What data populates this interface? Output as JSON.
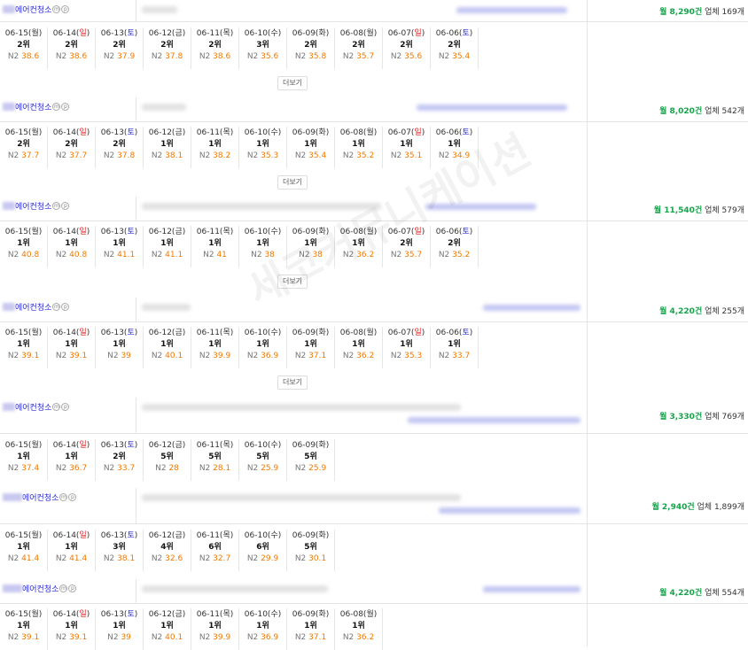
{
  "watermark": "세코커뮤니케이션",
  "more_label": "더보기",
  "mini_badges": [
    "m",
    "p"
  ],
  "blocks": [
    {
      "keyword": "에어컨청소",
      "volume": "월 8,290건",
      "companies": "업체 169개",
      "has_more": true,
      "days": [
        {
          "date": "06-15",
          "wd": "월",
          "rank": "2위",
          "n2": "38.6"
        },
        {
          "date": "06-14",
          "wd": "일",
          "rank": "2위",
          "n2": "38.6"
        },
        {
          "date": "06-13",
          "wd": "토",
          "rank": "2위",
          "n2": "37.9"
        },
        {
          "date": "06-12",
          "wd": "금",
          "rank": "2위",
          "n2": "37.8"
        },
        {
          "date": "06-11",
          "wd": "목",
          "rank": "2위",
          "n2": "38.6"
        },
        {
          "date": "06-10",
          "wd": "수",
          "rank": "3위",
          "n2": "35.6"
        },
        {
          "date": "06-09",
          "wd": "화",
          "rank": "2위",
          "n2": "35.8"
        },
        {
          "date": "06-08",
          "wd": "월",
          "rank": "2위",
          "n2": "35.7"
        },
        {
          "date": "06-07",
          "wd": "일",
          "rank": "2위",
          "n2": "35.6"
        },
        {
          "date": "06-06",
          "wd": "토",
          "rank": "2위",
          "n2": "35.4"
        }
      ]
    },
    {
      "keyword": "에어컨청소",
      "volume": "월 8,020건",
      "companies": "업체 542개",
      "has_more": true,
      "days": [
        {
          "date": "06-15",
          "wd": "월",
          "rank": "2위",
          "n2": "37.7"
        },
        {
          "date": "06-14",
          "wd": "일",
          "rank": "2위",
          "n2": "37.7"
        },
        {
          "date": "06-13",
          "wd": "토",
          "rank": "2위",
          "n2": "37.8"
        },
        {
          "date": "06-12",
          "wd": "금",
          "rank": "1위",
          "n2": "38.1"
        },
        {
          "date": "06-11",
          "wd": "목",
          "rank": "1위",
          "n2": "38.2"
        },
        {
          "date": "06-10",
          "wd": "수",
          "rank": "1위",
          "n2": "35.3"
        },
        {
          "date": "06-09",
          "wd": "화",
          "rank": "1위",
          "n2": "35.4"
        },
        {
          "date": "06-08",
          "wd": "월",
          "rank": "1위",
          "n2": "35.2"
        },
        {
          "date": "06-07",
          "wd": "일",
          "rank": "1위",
          "n2": "35.1"
        },
        {
          "date": "06-06",
          "wd": "토",
          "rank": "1위",
          "n2": "34.9"
        }
      ]
    },
    {
      "keyword": "에어컨청소",
      "volume": "월 11,540건",
      "companies": "업체 579개",
      "has_more": true,
      "days": [
        {
          "date": "06-15",
          "wd": "월",
          "rank": "1위",
          "n2": "40.8"
        },
        {
          "date": "06-14",
          "wd": "일",
          "rank": "1위",
          "n2": "40.8"
        },
        {
          "date": "06-13",
          "wd": "토",
          "rank": "1위",
          "n2": "41.1"
        },
        {
          "date": "06-12",
          "wd": "금",
          "rank": "1위",
          "n2": "41.1"
        },
        {
          "date": "06-11",
          "wd": "목",
          "rank": "1위",
          "n2": "41"
        },
        {
          "date": "06-10",
          "wd": "수",
          "rank": "1위",
          "n2": "38"
        },
        {
          "date": "06-09",
          "wd": "화",
          "rank": "1위",
          "n2": "38"
        },
        {
          "date": "06-08",
          "wd": "월",
          "rank": "1위",
          "n2": "36.2"
        },
        {
          "date": "06-07",
          "wd": "일",
          "rank": "2위",
          "n2": "35.7"
        },
        {
          "date": "06-06",
          "wd": "토",
          "rank": "2위",
          "n2": "35.2"
        }
      ]
    },
    {
      "keyword": "에어컨청소",
      "volume": "월 4,220건",
      "companies": "업체 255개",
      "has_more": true,
      "days": [
        {
          "date": "06-15",
          "wd": "월",
          "rank": "1위",
          "n2": "39.1"
        },
        {
          "date": "06-14",
          "wd": "일",
          "rank": "1위",
          "n2": "39.1"
        },
        {
          "date": "06-13",
          "wd": "토",
          "rank": "1위",
          "n2": "39"
        },
        {
          "date": "06-12",
          "wd": "금",
          "rank": "1위",
          "n2": "40.1"
        },
        {
          "date": "06-11",
          "wd": "목",
          "rank": "1위",
          "n2": "39.9"
        },
        {
          "date": "06-10",
          "wd": "수",
          "rank": "1위",
          "n2": "36.9"
        },
        {
          "date": "06-09",
          "wd": "화",
          "rank": "1위",
          "n2": "37.1"
        },
        {
          "date": "06-08",
          "wd": "월",
          "rank": "1위",
          "n2": "36.2"
        },
        {
          "date": "06-07",
          "wd": "일",
          "rank": "1위",
          "n2": "35.3"
        },
        {
          "date": "06-06",
          "wd": "토",
          "rank": "1위",
          "n2": "33.7"
        }
      ]
    },
    {
      "keyword": "에어컨청소",
      "volume": "월 3,330건",
      "companies": "업체 769개",
      "has_more": false,
      "days": [
        {
          "date": "06-15",
          "wd": "월",
          "rank": "1위",
          "n2": "37.4"
        },
        {
          "date": "06-14",
          "wd": "일",
          "rank": "1위",
          "n2": "36.7"
        },
        {
          "date": "06-13",
          "wd": "토",
          "rank": "2위",
          "n2": "33.7"
        },
        {
          "date": "06-12",
          "wd": "금",
          "rank": "5위",
          "n2": "28"
        },
        {
          "date": "06-11",
          "wd": "목",
          "rank": "5위",
          "n2": "28.1"
        },
        {
          "date": "06-10",
          "wd": "수",
          "rank": "5위",
          "n2": "25.9"
        },
        {
          "date": "06-09",
          "wd": "화",
          "rank": "5위",
          "n2": "25.9"
        }
      ]
    },
    {
      "keyword": "에어컨청소",
      "volume": "월 2,940건",
      "companies": "업체 1,899개",
      "has_more": false,
      "days": [
        {
          "date": "06-15",
          "wd": "월",
          "rank": "1위",
          "n2": "41.4"
        },
        {
          "date": "06-14",
          "wd": "일",
          "rank": "1위",
          "n2": "41.4"
        },
        {
          "date": "06-13",
          "wd": "토",
          "rank": "3위",
          "n2": "38.1"
        },
        {
          "date": "06-12",
          "wd": "금",
          "rank": "4위",
          "n2": "32.6"
        },
        {
          "date": "06-11",
          "wd": "목",
          "rank": "6위",
          "n2": "32.7"
        },
        {
          "date": "06-10",
          "wd": "수",
          "rank": "6위",
          "n2": "29.9"
        },
        {
          "date": "06-09",
          "wd": "화",
          "rank": "5위",
          "n2": "30.1"
        }
      ]
    },
    {
      "keyword": "에어컨청소",
      "volume": "월 4,220건",
      "companies": "업체 554개",
      "has_more": false,
      "days": [
        {
          "date": "06-15",
          "wd": "월",
          "rank": "1위",
          "n2": "39.1"
        },
        {
          "date": "06-14",
          "wd": "일",
          "rank": "1위",
          "n2": "39.1"
        },
        {
          "date": "06-13",
          "wd": "토",
          "rank": "1위",
          "n2": "39"
        },
        {
          "date": "06-12",
          "wd": "금",
          "rank": "1위",
          "n2": "40.1"
        },
        {
          "date": "06-11",
          "wd": "목",
          "rank": "1위",
          "n2": "39.9"
        },
        {
          "date": "06-10",
          "wd": "수",
          "rank": "1위",
          "n2": "36.9"
        },
        {
          "date": "06-09",
          "wd": "화",
          "rank": "1위",
          "n2": "37.1"
        },
        {
          "date": "06-08",
          "wd": "월",
          "rank": "1위",
          "n2": "36.2"
        }
      ]
    }
  ]
}
